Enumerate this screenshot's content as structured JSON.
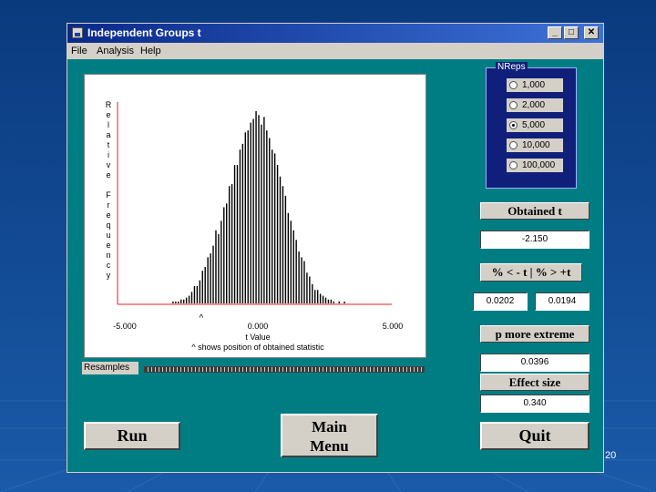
{
  "window": {
    "title": "Independent Groups t",
    "minimize_glyph": "_",
    "maximize_glyph": "□",
    "close_glyph": "✕"
  },
  "menu": {
    "items": [
      "File",
      "Analysis",
      "Help"
    ]
  },
  "chart_data": {
    "type": "bar",
    "title": "",
    "xlabel": "t Value",
    "ylabel": "Relative Frequency",
    "x_tick_labels": [
      "-5.000",
      "0.000",
      "5.000"
    ],
    "xlim": [
      -5,
      5
    ],
    "marker_glyph": "^",
    "annotation": "^ shows position of obtained statistic",
    "obtained_t": -2.15,
    "grid": false,
    "series": [
      {
        "x": [
          -3.2,
          -3.1,
          -3.0,
          -2.9,
          -2.8,
          -2.7,
          -2.6,
          -2.5,
          -2.4,
          -2.3,
          -2.2,
          -2.1,
          -2.0,
          -1.9,
          -1.8,
          -1.7,
          -1.6,
          -1.5,
          -1.4,
          -1.3,
          -1.2,
          -1.1,
          -1.0,
          -0.9,
          -0.8,
          -0.7,
          -0.6,
          -0.5,
          -0.4,
          -0.3,
          -0.2,
          -0.1,
          0.0,
          0.1,
          0.2,
          0.3,
          0.4,
          0.5,
          0.6,
          0.7,
          0.8,
          0.9,
          1.0,
          1.1,
          1.2,
          1.3,
          1.4,
          1.5,
          1.6,
          1.7,
          1.8,
          1.9,
          2.0,
          2.1,
          2.2,
          2.3,
          2.4,
          2.5,
          2.6,
          2.7,
          2.8,
          3.0,
          3.2
        ],
        "values": [
          0.01,
          0.01,
          0.01,
          0.02,
          0.02,
          0.03,
          0.04,
          0.06,
          0.09,
          0.09,
          0.12,
          0.17,
          0.19,
          0.24,
          0.26,
          0.3,
          0.38,
          0.36,
          0.43,
          0.5,
          0.52,
          0.61,
          0.62,
          0.72,
          0.72,
          0.8,
          0.83,
          0.89,
          0.9,
          0.94,
          0.96,
          1.0,
          0.98,
          0.93,
          0.97,
          0.9,
          0.86,
          0.8,
          0.78,
          0.72,
          0.66,
          0.61,
          0.56,
          0.47,
          0.43,
          0.38,
          0.33,
          0.27,
          0.24,
          0.22,
          0.16,
          0.14,
          0.1,
          0.07,
          0.07,
          0.05,
          0.04,
          0.03,
          0.02,
          0.02,
          0.01,
          0.01,
          0.01
        ]
      }
    ]
  },
  "resamples": {
    "label": "Resamples",
    "progress": 1.0
  },
  "nreps": {
    "title": "NReps",
    "options": [
      "1,000",
      "2,000",
      "5,000",
      "10,000",
      "100,000"
    ],
    "selected_index": 2
  },
  "stats": {
    "obtained_t_label": "Obtained t",
    "obtained_t_value": "-2.150",
    "pct_label": "% < - t | % > +t",
    "pct_below": "0.0202",
    "pct_above": "0.0194",
    "p_extreme_label": "p more extreme",
    "p_extreme_value": "0.0396",
    "effect_size_label": "Effect size",
    "effect_size_value": "0.340"
  },
  "buttons": {
    "run": "Run",
    "main_menu_line1": "Main",
    "main_menu_line2": "Menu",
    "quit": "Quit"
  },
  "slide": {
    "page_number": "20"
  },
  "colors": {
    "window_bg": "#007d83",
    "title_bar": "#0a2a8a",
    "bar_color": "#000000",
    "axis_color": "#e02020"
  }
}
